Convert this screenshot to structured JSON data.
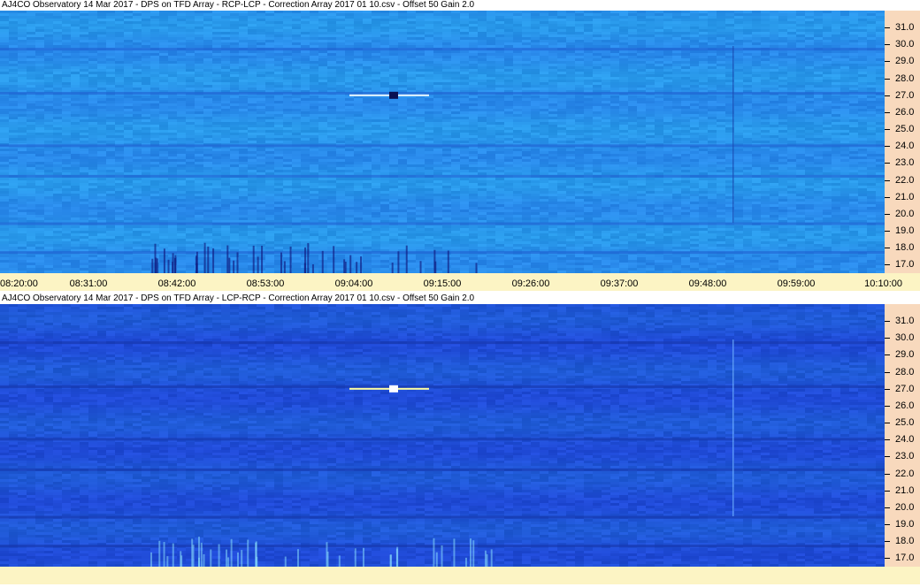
{
  "colors": {
    "axis_bg": "#f8d9bd",
    "time_bar_bg": "#fcf4c4",
    "panel1_base": "#2a8ff0",
    "panel2_base": "#1f50d8"
  },
  "chart_data": [
    {
      "type": "heatmap",
      "title": "AJ4CO Observatory 14 Mar 2017  -  DPS on TFD Array  -  RCP-LCP  -  Correction Array 2017 01 10.csv  -  Offset 50  Gain 2.0",
      "ylabel": "",
      "xlabel": "",
      "y_ticks": [
        "31.0",
        "30.0",
        "29.0",
        "28.0",
        "27.0",
        "26.0",
        "25.0",
        "24.0",
        "23.0",
        "22.0",
        "21.0",
        "20.0",
        "19.0",
        "18.0",
        "17.0"
      ],
      "x_ticks": [
        "08:20:00",
        "08:31:00",
        "08:42:00",
        "08:53:00",
        "09:04:00",
        "09:15:00",
        "09:26:00",
        "09:37:00",
        "09:48:00",
        "09:59:00",
        "10:10:00"
      ],
      "ylim": [
        16.5,
        32.0
      ],
      "palette": "blue"
    },
    {
      "type": "heatmap",
      "title": "AJ4CO Observatory 14 Mar 2017  -  DPS on TFD Array  -  LCP-RCP  -  Correction Array 2017 01 10.csv  -  Offset 50  Gain 2.0",
      "ylabel": "",
      "xlabel": "",
      "y_ticks": [
        "31.0",
        "30.0",
        "29.0",
        "28.0",
        "27.0",
        "26.0",
        "25.0",
        "24.0",
        "23.0",
        "22.0",
        "21.0",
        "20.0",
        "19.0",
        "18.0",
        "17.0"
      ],
      "x_ticks": [],
      "ylim": [
        16.5,
        32.0
      ],
      "palette": "deep-blue"
    }
  ]
}
